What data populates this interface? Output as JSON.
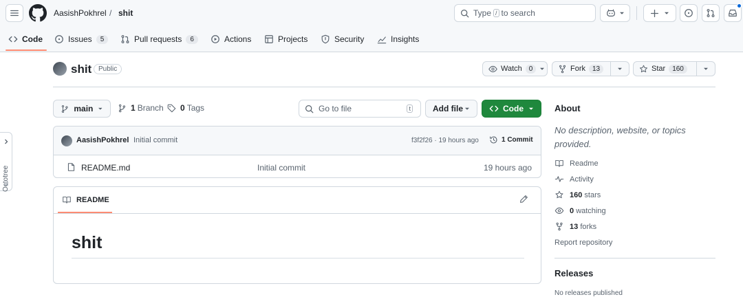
{
  "header": {
    "owner": "AasishPokhrel",
    "separator": "/",
    "repo": "shit",
    "search": {
      "prefix": "Type",
      "key": "/",
      "suffix": "to search"
    }
  },
  "tabs": [
    {
      "label": "Code"
    },
    {
      "label": "Issues",
      "count": "5"
    },
    {
      "label": "Pull requests",
      "count": "6"
    },
    {
      "label": "Actions"
    },
    {
      "label": "Projects"
    },
    {
      "label": "Security"
    },
    {
      "label": "Insights"
    }
  ],
  "repo": {
    "name": "shit",
    "visibility": "Public",
    "watch": {
      "label": "Watch",
      "count": "0"
    },
    "fork": {
      "label": "Fork",
      "count": "13"
    },
    "star": {
      "label": "Star",
      "count": "160"
    }
  },
  "toolbar": {
    "branch": "main",
    "branches_count": "1",
    "branches_label": "Branch",
    "tags_count": "0",
    "tags_label": "Tags",
    "goto_placeholder": "Go to file",
    "goto_key": "t",
    "add_file": "Add file",
    "code": "Code"
  },
  "commit": {
    "author": "AasishPokhrel",
    "message": "Initial commit",
    "meta": "f3f2f26 · 19 hours ago",
    "commits_label": "1 Commit"
  },
  "files": [
    {
      "name": "README.md",
      "message": "Initial commit",
      "time": "19 hours ago"
    }
  ],
  "readme": {
    "tab": "README",
    "heading": "shit"
  },
  "about": {
    "title": "About",
    "description": "No description, website, or topics provided.",
    "links": {
      "readme": "Readme",
      "activity": "Activity",
      "stars": {
        "count": "160",
        "label": "stars"
      },
      "watching": {
        "count": "0",
        "label": "watching"
      },
      "forks": {
        "count": "13",
        "label": "forks"
      }
    },
    "report": "Report repository"
  },
  "releases": {
    "title": "Releases",
    "text": "No releases published"
  },
  "octotree": {
    "label": "Octotree"
  },
  "colors": {
    "accent": "#1f883d",
    "tab_underline": "#fd8c73",
    "notification_dot": "#0969da"
  }
}
